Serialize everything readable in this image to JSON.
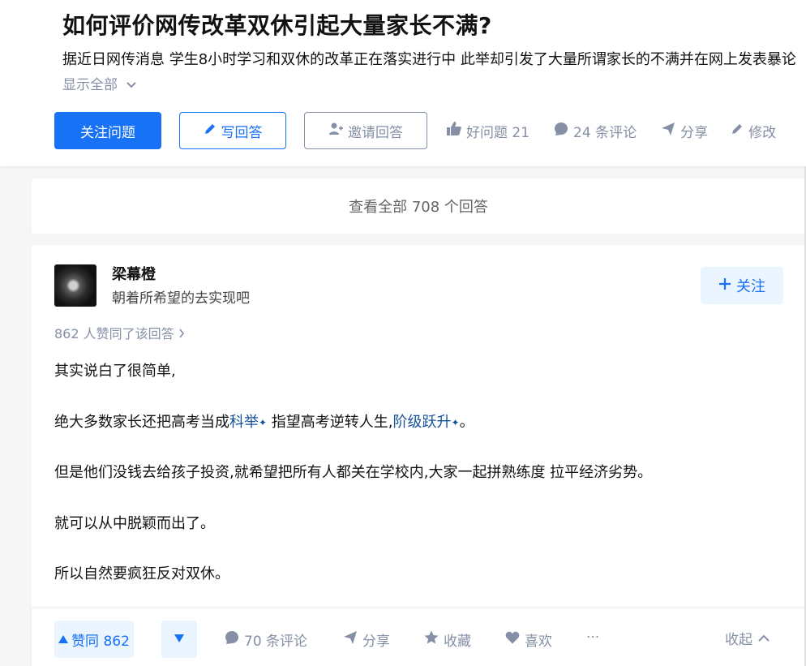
{
  "question": {
    "title": "如何评价网传改革双休引起大量家长不满?",
    "description": "据近日网传消息 学生8小时学习和双休的改革正在落实进行中 此举却引发了大量所谓家长的不满并在网上发表暴论",
    "show_all_label": "显示全部",
    "follow_label": "关注问题",
    "write_answer_label": "写回答",
    "invite_label": "邀请回答",
    "good_question_label": "好问题 21",
    "comments_label": "24 条评论",
    "share_label": "分享",
    "edit_label": "修改"
  },
  "view_all_label": "查看全部 708 个回答",
  "answer": {
    "author_name": "梁幕橙",
    "author_bio": "朝着所希望的去实现吧",
    "follow_label": "关注",
    "vote_summary": "862 人赞同了该回答",
    "paragraphs": {
      "p1": "其实说白了很简单,",
      "p2_a": "绝大多数家长还把高考当成",
      "p2_link1": "科举",
      "p2_b": " 指望高考逆转人生,",
      "p2_link2": "阶级跃升",
      "p2_c": "。",
      "p3": "但是他们没钱去给孩子投资,就希望把所有人都关在学校内,大家一起拼熟练度 拉平经济劣势。",
      "p4": "就可以从中脱颖而出了。",
      "p5": "所以自然要疯狂反对双休。"
    }
  },
  "actionbar": {
    "upvote_label": "赞同 862",
    "comments_label": "70 条评论",
    "share_label": "分享",
    "collect_label": "收藏",
    "like_label": "喜欢",
    "more_label": "···",
    "collapse_label": "收起"
  },
  "colors": {
    "brand_blue": "#1772f6",
    "link_blue": "#175199",
    "muted_gray": "#8590a6"
  }
}
